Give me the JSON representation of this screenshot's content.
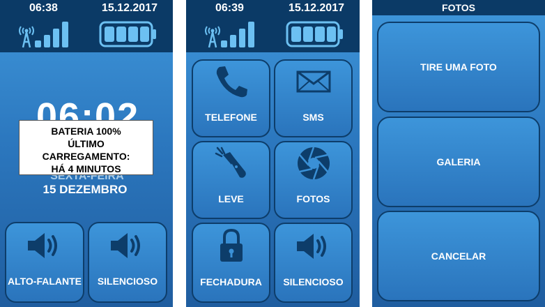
{
  "screen1": {
    "status": {
      "time": "06:38",
      "date": "15.12.2017"
    },
    "clock": "06:02",
    "day_name": "SEXTA-FEIRA",
    "day_date": "15 DEZEMBRO",
    "popup": {
      "line1": "BATERIA 100%",
      "line2": "ÚLTIMO",
      "line3": "CARREGAMENTO:",
      "line4": "HÁ 4 MINUTOS"
    },
    "buttons": [
      {
        "label": "ALTO-FALANTE",
        "icon": "speaker-icon"
      },
      {
        "label": "SILENCIOSO",
        "icon": "speaker-icon"
      }
    ]
  },
  "screen2": {
    "status": {
      "time": "06:39",
      "date": "15.12.2017"
    },
    "tiles": [
      {
        "label": "TELEFONE",
        "icon": "phone-icon"
      },
      {
        "label": "SMS",
        "icon": "envelope-icon"
      },
      {
        "label": "LEVE",
        "icon": "flashlight-icon"
      },
      {
        "label": "FOTOS",
        "icon": "camera-shutter-icon"
      },
      {
        "label": "FECHADURA",
        "icon": "lock-icon"
      },
      {
        "label": "SILENCIOSO",
        "icon": "speaker-icon"
      }
    ]
  },
  "screen3": {
    "title": "FOTOS",
    "buttons": [
      {
        "label": "TIRE UMA FOTO"
      },
      {
        "label": "GALERIA"
      },
      {
        "label": "CANCELAR"
      }
    ]
  },
  "battery_level": 1.0,
  "colors": {
    "statusbar": "#0b3a66",
    "tile_border": "#0d3d6a",
    "tile": "#3a90d6",
    "icon": "#0d3d6a"
  }
}
